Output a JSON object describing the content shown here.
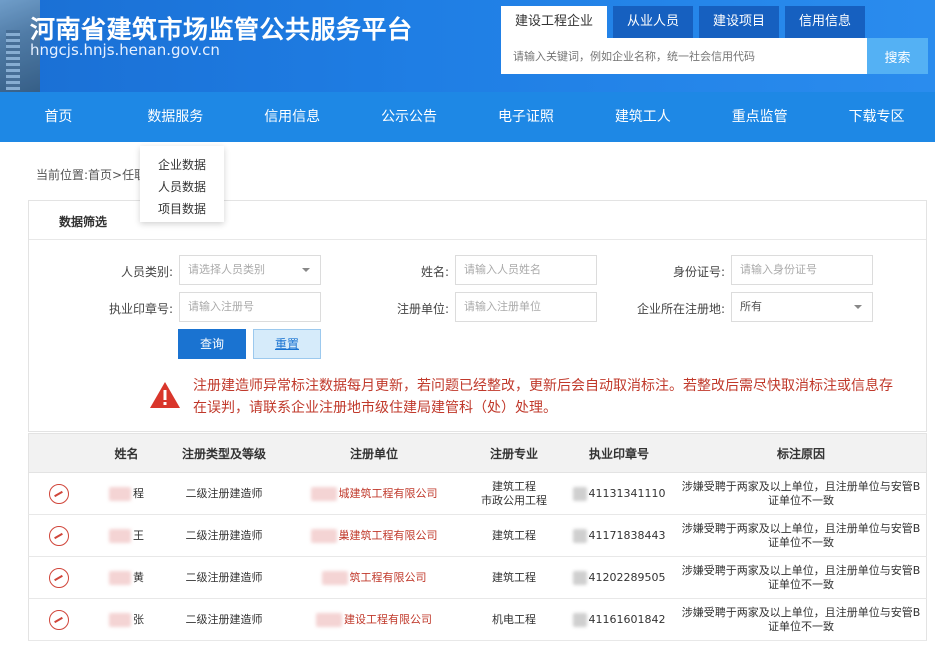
{
  "header": {
    "title": "河南省建筑市场监管公共服务平台",
    "domain": "hngcjs.hnjs.henan.gov.cn",
    "search_tabs": [
      "建设工程企业",
      "从业人员",
      "建设项目",
      "信用信息"
    ],
    "search_placeholder": "请输入关键词，例如企业名称，统一社会信用代码",
    "search_button": "搜索"
  },
  "nav": {
    "items": [
      "首页",
      "数据服务",
      "信用信息",
      "公示公告",
      "电子证照",
      "建筑工人",
      "重点监管",
      "下载专区"
    ],
    "dropdown": [
      "企业数据",
      "人员数据",
      "项目数据"
    ]
  },
  "breadcrumb": "当前位置:首页>任职人员",
  "filter": {
    "title": "数据筛选",
    "person_type_label": "人员类别:",
    "person_type_placeholder": "请选择人员类别",
    "name_label": "姓名:",
    "name_placeholder": "请输入人员姓名",
    "id_label": "身份证号:",
    "id_placeholder": "请输入身份证号",
    "seal_label": "执业印章号:",
    "seal_placeholder": "请输入注册号",
    "unit_label": "注册单位:",
    "unit_placeholder": "请输入注册单位",
    "region_label": "企业所在注册地:",
    "region_value": "所有",
    "query_button": "查询",
    "reset_button": "重置"
  },
  "notice": "注册建造师异常标注数据每月更新，若问题已经整改，更新后会自动取消标注。若整改后需尽快取消标注或信息存在误判，请联系企业注册地市级住建局建管科（处）处理。",
  "table": {
    "headers": [
      "姓名",
      "注册类型及等级",
      "注册单位",
      "注册专业",
      "执业印章号",
      "标注原因"
    ],
    "rows": [
      {
        "name": "程",
        "level": "二级注册建造师",
        "unit": "城建筑工程有限公司",
        "major": "建筑工程\n市政公用工程",
        "seal": "41131341110",
        "reason": "涉嫌受聘于两家及以上单位，且注册单位与安管B证单位不一致"
      },
      {
        "name": "王",
        "level": "二级注册建造师",
        "unit": "巢建筑工程有限公司",
        "major": "建筑工程",
        "seal": "41171838443",
        "reason": "涉嫌受聘于两家及以上单位，且注册单位与安管B证单位不一致"
      },
      {
        "name": "黄",
        "level": "二级注册建造师",
        "unit": "筑工程有限公司",
        "major": "建筑工程",
        "seal": "41202289505",
        "reason": "涉嫌受聘于两家及以上单位，且注册单位与安管B证单位不一致"
      },
      {
        "name": "张",
        "level": "二级注册建造师",
        "unit": "建设工程有限公司",
        "major": "机电工程",
        "seal": "41161601842",
        "reason": "涉嫌受聘于两家及以上单位，且注册单位与安管B证单位不一致"
      }
    ]
  },
  "colors": {
    "brand_blue": "#1e88e5",
    "warning_red": "#c0392b"
  }
}
